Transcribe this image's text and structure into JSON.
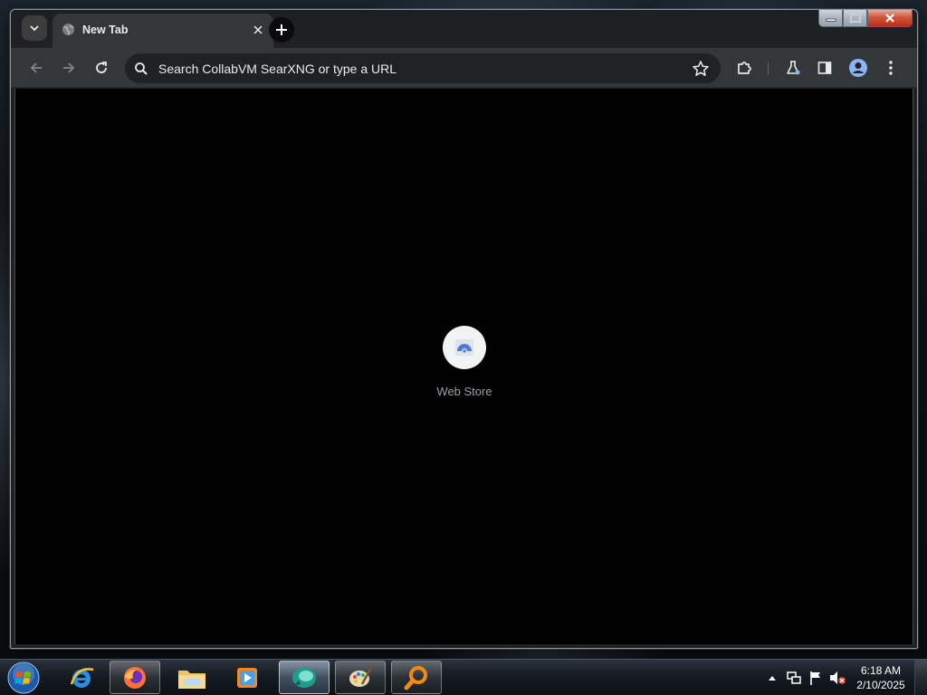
{
  "browser": {
    "tab": {
      "title": "New Tab"
    },
    "omnibox": {
      "placeholder": "Search CollabVM SearXNG or type a URL"
    },
    "icons": {
      "tab_search": "chevron-down-icon",
      "favicon": "globe-icon",
      "close_tab": "close-icon",
      "new_tab": "plus-icon",
      "back": "arrow-left-icon",
      "forward": "arrow-right-icon",
      "reload": "reload-icon",
      "search": "search-icon",
      "bookmark": "star-icon",
      "extensions": "puzzle-icon",
      "labs": "flask-icon",
      "side_panel": "side-panel-icon",
      "profile": "avatar-icon",
      "menu": "kebab-menu-icon"
    }
  },
  "newtab": {
    "shortcuts": [
      {
        "label": "Web Store",
        "icon": "web-store-icon"
      }
    ]
  },
  "taskbar": {
    "pinned": [
      {
        "name": "internet-explorer",
        "icon": "ie-icon"
      },
      {
        "name": "firefox",
        "icon": "firefox-icon"
      },
      {
        "name": "file-explorer",
        "icon": "folder-icon"
      },
      {
        "name": "media-player",
        "icon": "media-player-icon"
      },
      {
        "name": "chrome-like",
        "icon": "app-icon"
      },
      {
        "name": "paint",
        "icon": "paint-icon"
      },
      {
        "name": "search-app",
        "icon": "magnifier-icon"
      }
    ],
    "clock": {
      "time": "6:18 AM",
      "date": "2/10/2025"
    }
  },
  "colors": {
    "toolbar": "#35363a",
    "tabstrip": "#202124",
    "content": "#000000",
    "text": "#e8eaed",
    "muted": "#9aa0a6"
  }
}
